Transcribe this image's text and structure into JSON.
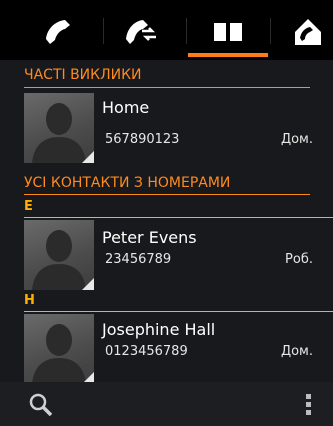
{
  "tabs": [
    {
      "icon": "phone-icon",
      "active": false
    },
    {
      "icon": "call-transfer-icon",
      "active": false
    },
    {
      "icon": "phonebook-icon",
      "active": true
    },
    {
      "icon": "house-phone-icon",
      "active": false
    }
  ],
  "frequent_calls": {
    "header": "ЧАСТІ ВИКЛИКИ",
    "items": [
      {
        "name": "Home",
        "number": "567890123",
        "type": "Дом."
      }
    ]
  },
  "all_contacts": {
    "header": "УСІ КОНТАКТИ З НОМЕРАМИ",
    "groups": [
      {
        "letter": "E",
        "items": [
          {
            "name": "Peter Evens",
            "number": "23456789",
            "type": "Роб."
          }
        ]
      },
      {
        "letter": "H",
        "items": [
          {
            "name": "Josephine Hall",
            "number": "0123456789",
            "type": "Дом."
          }
        ]
      }
    ]
  },
  "bottom_bar": {
    "left_icon": "search-icon",
    "right_icon": "more-vertical-icon"
  },
  "colors": {
    "accent": "#ff8a1f",
    "letter": "#ffb000",
    "underline": "#ff7a1a",
    "background": "#18191c"
  }
}
